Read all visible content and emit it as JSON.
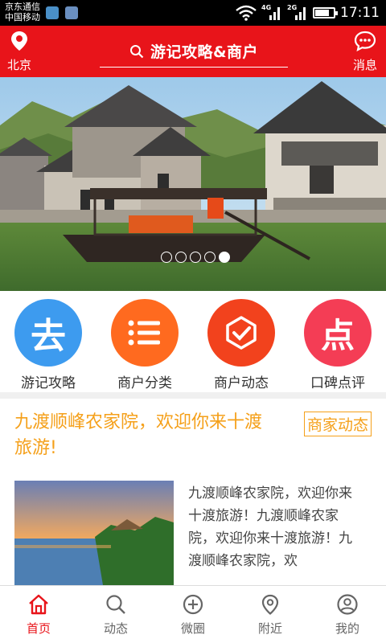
{
  "status_bar": {
    "carrier_1": "京东通信",
    "carrier_2": "中国移动",
    "net_1": "4G",
    "net_2": "2G",
    "time": "17:11",
    "battery_level": 0.7
  },
  "header": {
    "location": "北京",
    "search": "游记攻略&商户",
    "message": "消息"
  },
  "banner": {
    "slide_count": 5,
    "active_slide": 5
  },
  "categories": [
    {
      "label": "游记攻略",
      "glyph": "去",
      "color": "#3d9bef",
      "icon": "travel-guide-icon"
    },
    {
      "label": "商户分类",
      "color": "#ff6a1f",
      "icon": "list-icon"
    },
    {
      "label": "商户动态",
      "color": "#f2421d",
      "icon": "checkmark-shield-icon"
    },
    {
      "label": "口碑点评",
      "glyph": "点",
      "color": "#f43d55",
      "icon": "review-icon"
    }
  ],
  "news": {
    "title": "九渡顺峰农家院，欢迎你来十渡旅游!",
    "badge": "商家动态",
    "text": "九渡顺峰农家院，欢迎你来十渡旅游！九渡顺峰农家院，欢迎你来十渡旅游！九渡顺峰农家院，欢"
  },
  "nav": [
    {
      "label": "首页",
      "icon": "home-icon",
      "active": true
    },
    {
      "label": "动态",
      "icon": "search-icon",
      "active": false
    },
    {
      "label": "微圈",
      "icon": "plus-circle-icon",
      "active": false
    },
    {
      "label": "附近",
      "icon": "location-pin-icon",
      "active": false
    },
    {
      "label": "我的",
      "icon": "user-icon",
      "active": false
    }
  ],
  "colors": {
    "brand_red": "#e8141a",
    "accent_orange": "#f5a01a"
  }
}
